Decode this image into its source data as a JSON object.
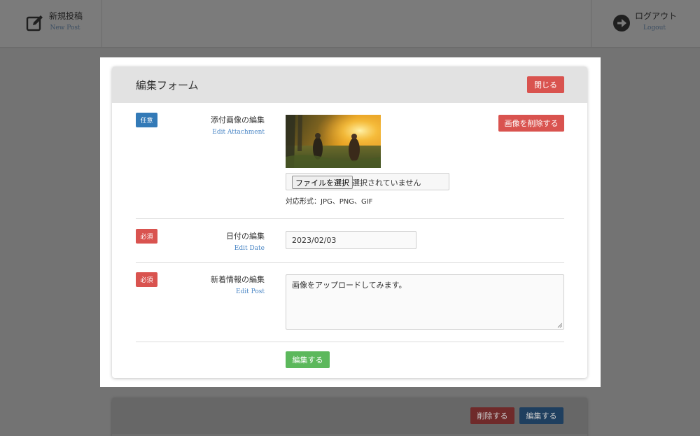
{
  "nav": {
    "new_post": {
      "label": "新規投稿",
      "sublabel": "New Post",
      "icon": "edit-square-icon"
    },
    "logout": {
      "label": "ログアウト",
      "sublabel": "Logout",
      "icon": "arrow-circle-right-icon"
    }
  },
  "modal": {
    "title": "編集フォーム",
    "close_button": "閉じる",
    "fields": {
      "attachment": {
        "badge": "任意",
        "label": "添付画像の編集",
        "sublabel": "Edit Attachment",
        "delete_image_button": "画像を削除する",
        "file_button": "ファイルを選択",
        "file_status": "選択されていません",
        "formats": "対応形式：JPG、PNG、GIF"
      },
      "date": {
        "badge": "必須",
        "label": "日付の編集",
        "sublabel": "Edit Date",
        "value": "2023/02/03"
      },
      "content": {
        "badge": "必須",
        "label": "新着情報の編集",
        "sublabel": "Edit Post",
        "value": "画像をアップロードしてみます。"
      }
    },
    "submit_button": "編集する"
  },
  "background_card": {
    "delete_button": "削除する",
    "edit_button": "編集する"
  },
  "colors": {
    "danger": "#d9534f",
    "primary": "#337ab7",
    "success": "#5cb85c",
    "header_bg": "#e2e2e2",
    "overlay": "#737373"
  }
}
